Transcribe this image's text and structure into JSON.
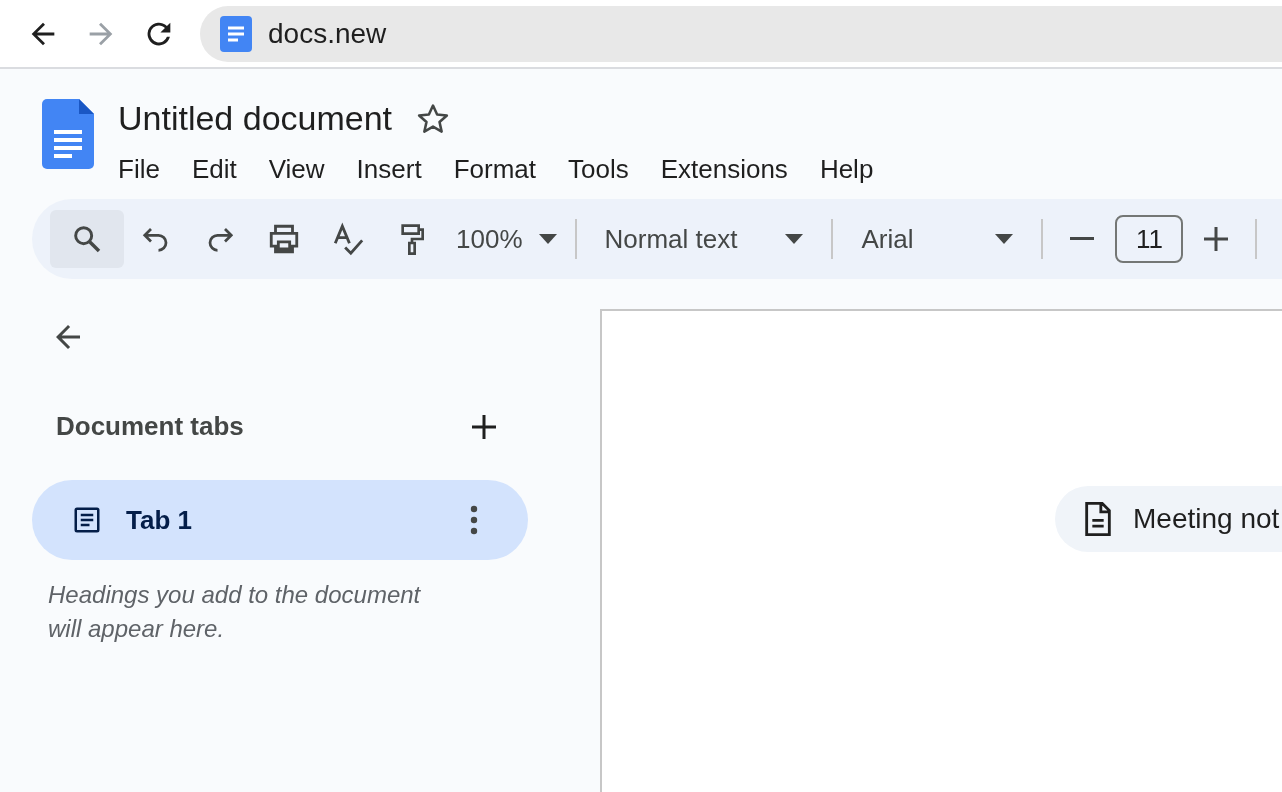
{
  "browser": {
    "back_enabled": true,
    "forward_enabled": false,
    "url": "docs.new"
  },
  "document": {
    "title": "Untitled document",
    "starred": false
  },
  "menu": [
    "File",
    "Edit",
    "View",
    "Insert",
    "Format",
    "Tools",
    "Extensions",
    "Help"
  ],
  "toolbar": {
    "zoom": "100%",
    "style": "Normal text",
    "font": "Arial",
    "font_size": "11"
  },
  "sidebar": {
    "heading": "Document tabs",
    "tabs": [
      {
        "label": "Tab 1",
        "selected": true
      }
    ],
    "hint": "Headings you add to the document will appear here."
  },
  "page": {
    "chips": [
      {
        "label": "Meeting not"
      }
    ]
  }
}
